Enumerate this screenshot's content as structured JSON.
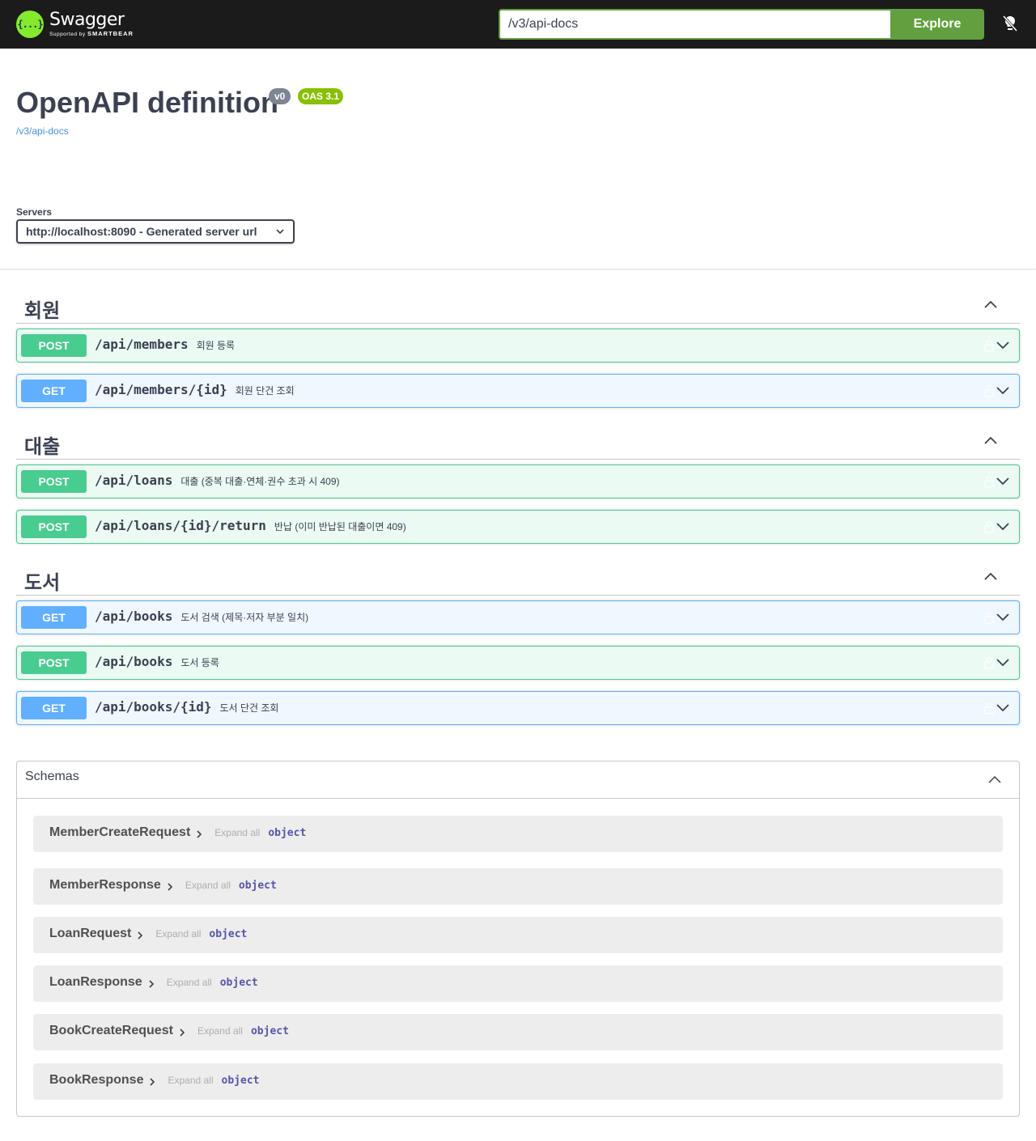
{
  "topbar": {
    "logo_name": "Swagger",
    "logo_supported": "Supported by",
    "logo_brand": "SMARTBEAR",
    "logo_glyph": "{...}",
    "url_value": "/v3/api-docs",
    "explore_label": "Explore"
  },
  "info": {
    "title": "OpenAPI definition",
    "version_badge": "v0",
    "oas_badge": "OAS 3.1",
    "spec_link": "/v3/api-docs"
  },
  "servers": {
    "label": "Servers",
    "selected": "http://localhost:8090 - Generated server url"
  },
  "tags": [
    {
      "name": "회원",
      "operations": [
        {
          "method": "POST",
          "path": "/api/members",
          "summary": "회원 등록"
        },
        {
          "method": "GET",
          "path": "/api/members/{id}",
          "summary": "회원 단건 조회"
        }
      ]
    },
    {
      "name": "대출",
      "operations": [
        {
          "method": "POST",
          "path": "/api/loans",
          "summary": "대출 (중복 대출·연체·권수 초과 시 409)"
        },
        {
          "method": "POST",
          "path": "/api/loans/{id}/return",
          "summary": "반납 (이미 반납된 대출이면 409)"
        }
      ]
    },
    {
      "name": "도서",
      "operations": [
        {
          "method": "GET",
          "path": "/api/books",
          "summary": "도서 검색 (제목·저자 부분 일치)"
        },
        {
          "method": "POST",
          "path": "/api/books",
          "summary": "도서 등록"
        },
        {
          "method": "GET",
          "path": "/api/books/{id}",
          "summary": "도서 단건 조회"
        }
      ]
    }
  ],
  "schemas": {
    "title": "Schemas",
    "models": [
      {
        "name": "MemberCreateRequest",
        "expand": "Expand all",
        "type": "object"
      },
      {
        "name": "MemberResponse",
        "expand": "Expand all",
        "type": "object"
      },
      {
        "name": "LoanRequest",
        "expand": "Expand all",
        "type": "object"
      },
      {
        "name": "LoanResponse",
        "expand": "Expand all",
        "type": "object"
      },
      {
        "name": "BookCreateRequest",
        "expand": "Expand all",
        "type": "object"
      },
      {
        "name": "BookResponse",
        "expand": "Expand all",
        "type": "object"
      }
    ]
  },
  "colors": {
    "post": "#49cc90",
    "get": "#61affe",
    "accent_green": "#62a03f",
    "oas_badge": "#89bf04"
  }
}
